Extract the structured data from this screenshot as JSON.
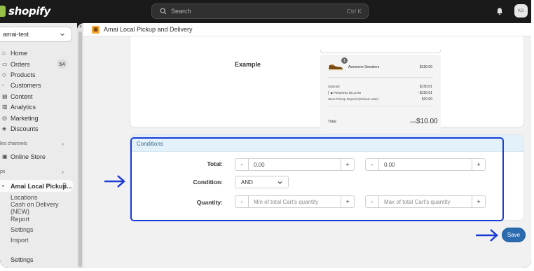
{
  "brand": {
    "name": "shopify"
  },
  "search": {
    "placeholder": "Search",
    "shortcut": "Ctrl K"
  },
  "user": {
    "initials": "KG"
  },
  "sidebar": {
    "store": "amai-test",
    "items": [
      {
        "label": "Home"
      },
      {
        "label": "Orders",
        "badge": "54"
      },
      {
        "label": "Products"
      },
      {
        "label": "Customers"
      },
      {
        "label": "Content"
      },
      {
        "label": "Analytics"
      },
      {
        "label": "Marketing"
      },
      {
        "label": "Discounts"
      }
    ],
    "sales_channels_label": "les channels",
    "online_store": "Online Store",
    "apps_label": "ps",
    "app_active": "Amai Local Pickup...",
    "app_sub": [
      "Locations",
      "Cash on Delivery (NEW)",
      "Report",
      "Settings",
      "Import"
    ],
    "settings": "Settings"
  },
  "app": {
    "title": "Amai Local Pickup and Delivery"
  },
  "example": {
    "label": "Example",
    "item_qty": "1",
    "item_name": "Awesome Sneakers",
    "item_price": "$150.00",
    "subtotal_label": "Subtotal",
    "subtotal_value": "$150.01",
    "pending_label": "PENDING BILLING",
    "pending_value": "- $150.01",
    "deposit_label": "Store Pickup Deposit (Refund Later)",
    "deposit_value": "$10.00",
    "total_label": "Total",
    "total_currency": "USD",
    "total_value": "$10.00"
  },
  "conditions": {
    "title": "Conditions",
    "total_label": "Total:",
    "total_min": "0.00",
    "total_max": "0.00",
    "condition_label": "Condition:",
    "condition_value": "AND",
    "quantity_label": "Quantity:",
    "quantity_min_placeholder": "Min of total Cart's quantity",
    "quantity_max_placeholder": "Max of total Cart's quantity",
    "minus": "-",
    "plus": "+"
  },
  "actions": {
    "save": "Save"
  },
  "colors": {
    "highlight": "#1a3bd6",
    "save": "#2b6cb0",
    "conditions_header": "#e3f1fa"
  }
}
